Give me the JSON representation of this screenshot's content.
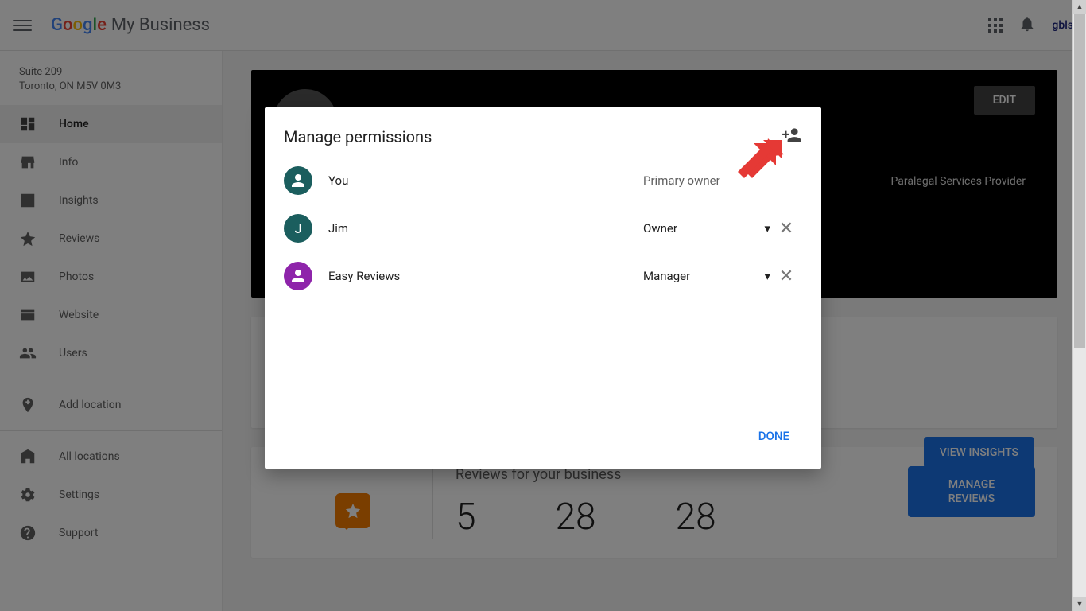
{
  "header": {
    "product": "My Business",
    "user_short": "gbls"
  },
  "business": {
    "line2": "Suite 209",
    "line3": "Toronto, ON M5V 0M3"
  },
  "nav": {
    "home": "Home",
    "info": "Info",
    "insights": "Insights",
    "reviews": "Reviews",
    "photos": "Photos",
    "website": "Website",
    "users": "Users",
    "add_location": "Add location",
    "all_locations": "All locations",
    "settings": "Settings",
    "support": "Support"
  },
  "hero": {
    "edit": "EDIT",
    "category": "Paralegal Services Provider"
  },
  "insights_card": {
    "button": "VIEW INSIGHTS"
  },
  "reviews_card": {
    "title": "Reviews for your business",
    "n1": "5",
    "n2": "28",
    "n3": "28",
    "button": "MANAGE REVIEWS"
  },
  "dialog": {
    "title": "Manage permissions",
    "done": "DONE",
    "rows": [
      {
        "name": "You",
        "role": "Primary owner",
        "avatar_bg": "#1b5e5e",
        "initial": "",
        "generic": true,
        "removable": false,
        "dropdown": false
      },
      {
        "name": "Jim",
        "role": "Owner",
        "avatar_bg": "#1b5e5e",
        "initial": "J",
        "generic": false,
        "removable": true,
        "dropdown": true
      },
      {
        "name": "Easy Reviews",
        "role": "Manager",
        "avatar_bg": "#8e24aa",
        "initial": "",
        "generic": true,
        "removable": true,
        "dropdown": true
      }
    ]
  }
}
